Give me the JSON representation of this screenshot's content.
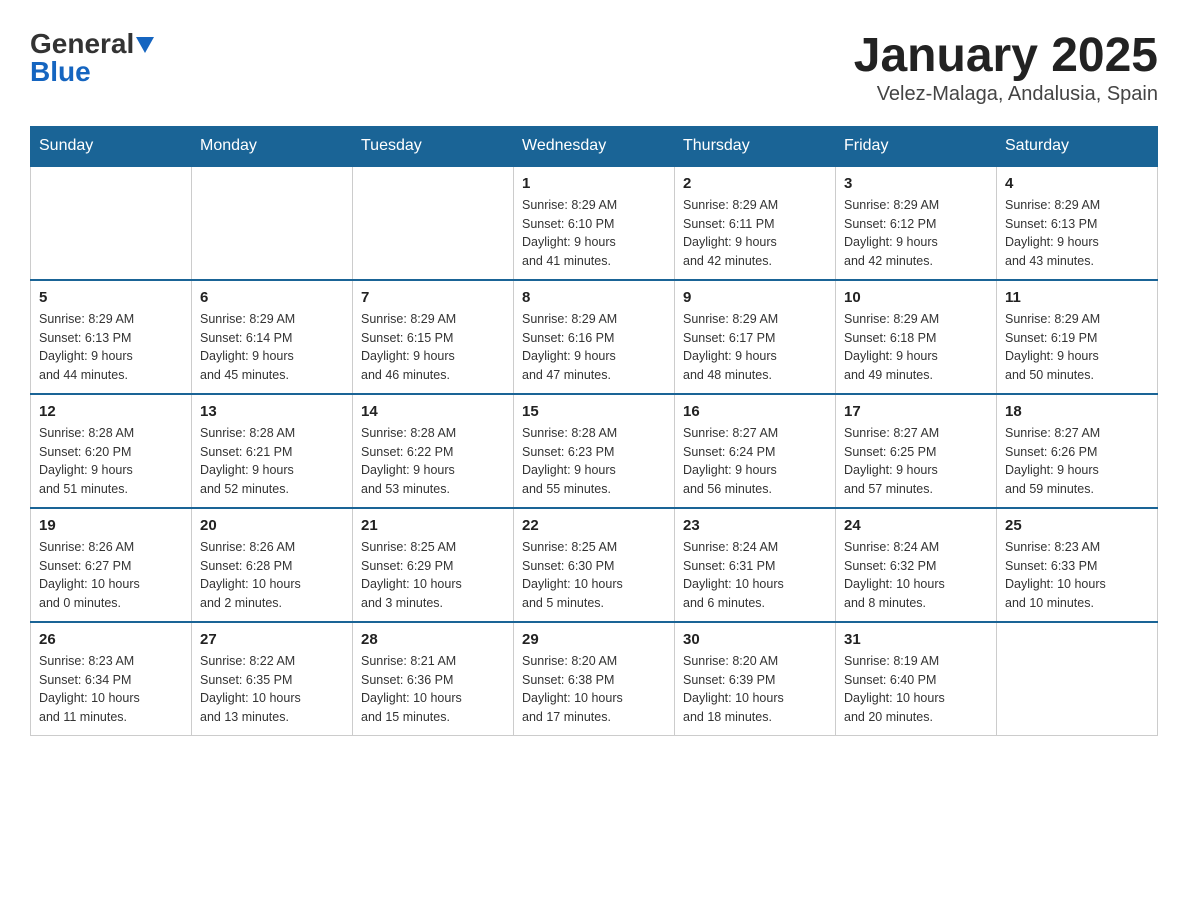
{
  "header": {
    "logo_general": "General",
    "logo_blue": "Blue",
    "title": "January 2025",
    "subtitle": "Velez-Malaga, Andalusia, Spain"
  },
  "weekdays": [
    "Sunday",
    "Monday",
    "Tuesday",
    "Wednesday",
    "Thursday",
    "Friday",
    "Saturday"
  ],
  "weeks": [
    [
      {
        "day": "",
        "info": ""
      },
      {
        "day": "",
        "info": ""
      },
      {
        "day": "",
        "info": ""
      },
      {
        "day": "1",
        "info": "Sunrise: 8:29 AM\nSunset: 6:10 PM\nDaylight: 9 hours\nand 41 minutes."
      },
      {
        "day": "2",
        "info": "Sunrise: 8:29 AM\nSunset: 6:11 PM\nDaylight: 9 hours\nand 42 minutes."
      },
      {
        "day": "3",
        "info": "Sunrise: 8:29 AM\nSunset: 6:12 PM\nDaylight: 9 hours\nand 42 minutes."
      },
      {
        "day": "4",
        "info": "Sunrise: 8:29 AM\nSunset: 6:13 PM\nDaylight: 9 hours\nand 43 minutes."
      }
    ],
    [
      {
        "day": "5",
        "info": "Sunrise: 8:29 AM\nSunset: 6:13 PM\nDaylight: 9 hours\nand 44 minutes."
      },
      {
        "day": "6",
        "info": "Sunrise: 8:29 AM\nSunset: 6:14 PM\nDaylight: 9 hours\nand 45 minutes."
      },
      {
        "day": "7",
        "info": "Sunrise: 8:29 AM\nSunset: 6:15 PM\nDaylight: 9 hours\nand 46 minutes."
      },
      {
        "day": "8",
        "info": "Sunrise: 8:29 AM\nSunset: 6:16 PM\nDaylight: 9 hours\nand 47 minutes."
      },
      {
        "day": "9",
        "info": "Sunrise: 8:29 AM\nSunset: 6:17 PM\nDaylight: 9 hours\nand 48 minutes."
      },
      {
        "day": "10",
        "info": "Sunrise: 8:29 AM\nSunset: 6:18 PM\nDaylight: 9 hours\nand 49 minutes."
      },
      {
        "day": "11",
        "info": "Sunrise: 8:29 AM\nSunset: 6:19 PM\nDaylight: 9 hours\nand 50 minutes."
      }
    ],
    [
      {
        "day": "12",
        "info": "Sunrise: 8:28 AM\nSunset: 6:20 PM\nDaylight: 9 hours\nand 51 minutes."
      },
      {
        "day": "13",
        "info": "Sunrise: 8:28 AM\nSunset: 6:21 PM\nDaylight: 9 hours\nand 52 minutes."
      },
      {
        "day": "14",
        "info": "Sunrise: 8:28 AM\nSunset: 6:22 PM\nDaylight: 9 hours\nand 53 minutes."
      },
      {
        "day": "15",
        "info": "Sunrise: 8:28 AM\nSunset: 6:23 PM\nDaylight: 9 hours\nand 55 minutes."
      },
      {
        "day": "16",
        "info": "Sunrise: 8:27 AM\nSunset: 6:24 PM\nDaylight: 9 hours\nand 56 minutes."
      },
      {
        "day": "17",
        "info": "Sunrise: 8:27 AM\nSunset: 6:25 PM\nDaylight: 9 hours\nand 57 minutes."
      },
      {
        "day": "18",
        "info": "Sunrise: 8:27 AM\nSunset: 6:26 PM\nDaylight: 9 hours\nand 59 minutes."
      }
    ],
    [
      {
        "day": "19",
        "info": "Sunrise: 8:26 AM\nSunset: 6:27 PM\nDaylight: 10 hours\nand 0 minutes."
      },
      {
        "day": "20",
        "info": "Sunrise: 8:26 AM\nSunset: 6:28 PM\nDaylight: 10 hours\nand 2 minutes."
      },
      {
        "day": "21",
        "info": "Sunrise: 8:25 AM\nSunset: 6:29 PM\nDaylight: 10 hours\nand 3 minutes."
      },
      {
        "day": "22",
        "info": "Sunrise: 8:25 AM\nSunset: 6:30 PM\nDaylight: 10 hours\nand 5 minutes."
      },
      {
        "day": "23",
        "info": "Sunrise: 8:24 AM\nSunset: 6:31 PM\nDaylight: 10 hours\nand 6 minutes."
      },
      {
        "day": "24",
        "info": "Sunrise: 8:24 AM\nSunset: 6:32 PM\nDaylight: 10 hours\nand 8 minutes."
      },
      {
        "day": "25",
        "info": "Sunrise: 8:23 AM\nSunset: 6:33 PM\nDaylight: 10 hours\nand 10 minutes."
      }
    ],
    [
      {
        "day": "26",
        "info": "Sunrise: 8:23 AM\nSunset: 6:34 PM\nDaylight: 10 hours\nand 11 minutes."
      },
      {
        "day": "27",
        "info": "Sunrise: 8:22 AM\nSunset: 6:35 PM\nDaylight: 10 hours\nand 13 minutes."
      },
      {
        "day": "28",
        "info": "Sunrise: 8:21 AM\nSunset: 6:36 PM\nDaylight: 10 hours\nand 15 minutes."
      },
      {
        "day": "29",
        "info": "Sunrise: 8:20 AM\nSunset: 6:38 PM\nDaylight: 10 hours\nand 17 minutes."
      },
      {
        "day": "30",
        "info": "Sunrise: 8:20 AM\nSunset: 6:39 PM\nDaylight: 10 hours\nand 18 minutes."
      },
      {
        "day": "31",
        "info": "Sunrise: 8:19 AM\nSunset: 6:40 PM\nDaylight: 10 hours\nand 20 minutes."
      },
      {
        "day": "",
        "info": ""
      }
    ]
  ]
}
